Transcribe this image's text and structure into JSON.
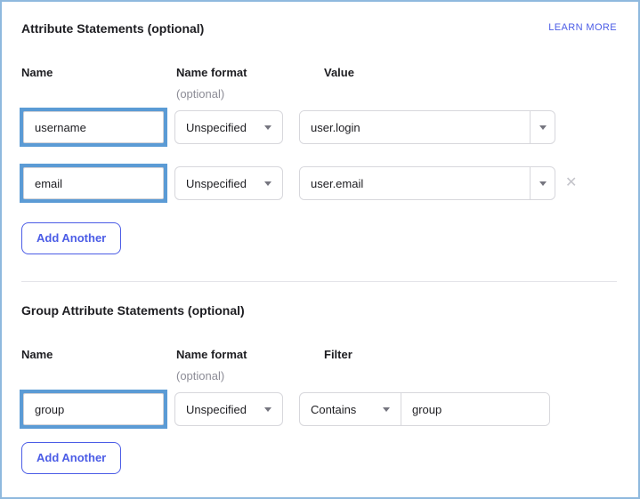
{
  "attribute_section": {
    "title": "Attribute Statements (optional)",
    "learn_more_label": "LEARN MORE",
    "columns": {
      "name": "Name",
      "name_format": "Name format",
      "name_format_hint": "(optional)",
      "value": "Value"
    },
    "rows": [
      {
        "name": "username",
        "name_format": "Unspecified",
        "value": "user.login"
      },
      {
        "name": "email",
        "name_format": "Unspecified",
        "value": "user.email"
      }
    ],
    "add_button_label": "Add Another"
  },
  "group_section": {
    "title": "Group Attribute Statements (optional)",
    "columns": {
      "name": "Name",
      "name_format": "Name format",
      "name_format_hint": "(optional)",
      "filter": "Filter"
    },
    "rows": [
      {
        "name": "group",
        "name_format": "Unspecified",
        "filter_type": "Contains",
        "filter_value": "group"
      }
    ],
    "add_button_label": "Add Another"
  },
  "icons": {
    "remove_glyph": "✕"
  },
  "colors": {
    "frame_border": "#8fb9de",
    "highlight_border": "#5b9bd5",
    "accent_blue": "#4b5ce6",
    "input_border": "#d7d7dc",
    "text": "#1d1d21",
    "muted_text": "#8c8c96",
    "remove_icon": "#c4c4ca"
  }
}
